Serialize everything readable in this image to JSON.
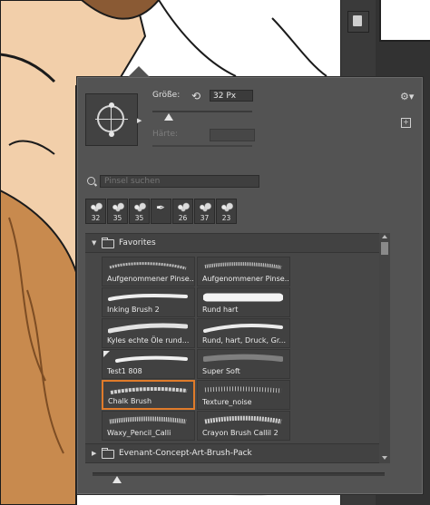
{
  "brush_panel": {
    "size_label": "Größe:",
    "size_value": "32 Px",
    "hardness_label": "Härte:",
    "search_placeholder": "Pinsel suchen",
    "recent_brushes": [
      {
        "size": "32",
        "icon": "brush-stamp-icon"
      },
      {
        "size": "35",
        "icon": "brush-stamp-icon"
      },
      {
        "size": "35",
        "icon": "brush-stamp-icon"
      },
      {
        "size": "",
        "icon": "pen-brush-icon"
      },
      {
        "size": "26",
        "icon": "brush-stamp-icon"
      },
      {
        "size": "37",
        "icon": "brush-stamp-icon"
      },
      {
        "size": "23",
        "icon": "brush-stamp-icon"
      }
    ],
    "groups": [
      {
        "name": "Favorites",
        "expanded": true
      },
      {
        "name": "Evenant-Concept-Art-Brush-Pack",
        "expanded": false
      }
    ],
    "presets": [
      {
        "name": "Aufgenommener Pinse..."
      },
      {
        "name": "Aufgenommener Pinse..."
      },
      {
        "name": "Inking Brush 2"
      },
      {
        "name": "Rund hart"
      },
      {
        "name": "Kyles echte Öle rund..."
      },
      {
        "name": "Rund, hart, Druck, Gr..."
      },
      {
        "name": "Test1 808"
      },
      {
        "name": "Super Soft"
      },
      {
        "name": "Chalk Brush",
        "selected": true
      },
      {
        "name": "Texture_noise"
      },
      {
        "name": "Waxy_Pencil_Calli"
      },
      {
        "name": "Crayon Brush Callil 2"
      }
    ],
    "preview_size": 0.1,
    "selection_color": "#e07b2a"
  }
}
